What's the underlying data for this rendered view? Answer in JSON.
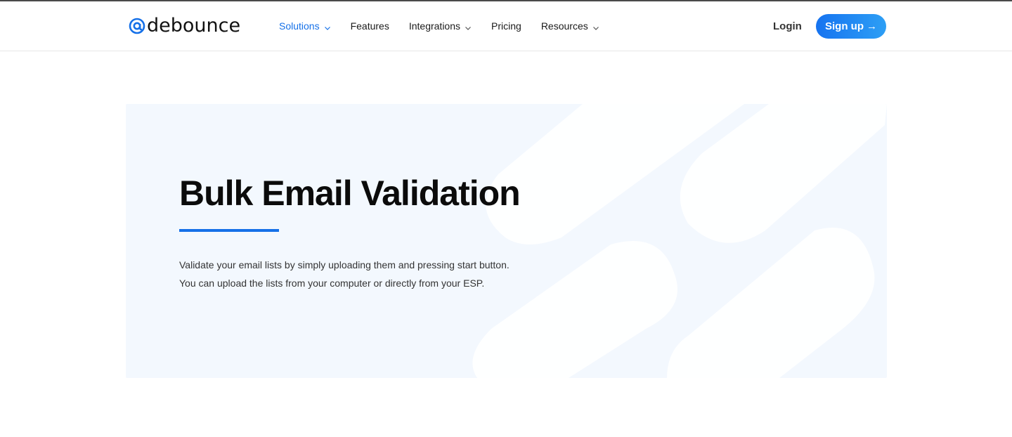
{
  "brand": {
    "name": "debounce",
    "accent": "#1570e8"
  },
  "nav": {
    "items": [
      {
        "label": "Solutions",
        "dropdown": true,
        "active": true
      },
      {
        "label": "Features",
        "dropdown": false,
        "active": false
      },
      {
        "label": "Integrations",
        "dropdown": true,
        "active": false
      },
      {
        "label": "Pricing",
        "dropdown": false,
        "active": false
      },
      {
        "label": "Resources",
        "dropdown": true,
        "active": false
      }
    ]
  },
  "auth": {
    "login_label": "Login",
    "signup_label": "Sign up",
    "signup_arrow": "→"
  },
  "hero": {
    "title": "Bulk Email Validation",
    "description": "Validate your email lists by simply uploading them and pressing start button. You can upload the lists from your computer or directly from your ESP.",
    "background": "#f3f8fe"
  }
}
